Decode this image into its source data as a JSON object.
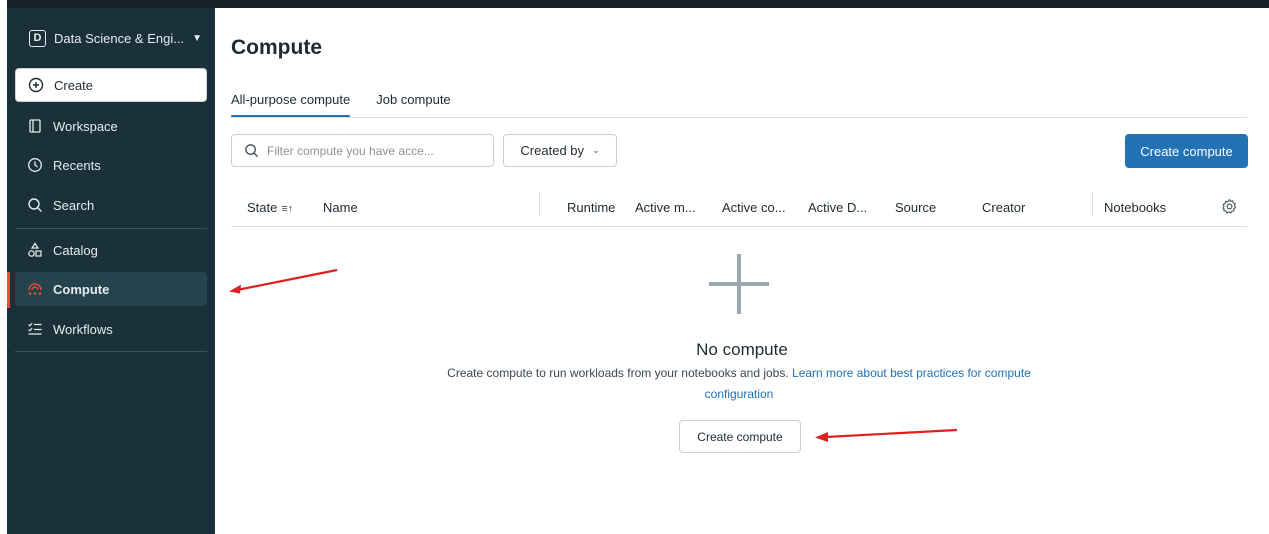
{
  "workspace": {
    "badge": "D",
    "name": "Data Science & Engi..."
  },
  "sidebar": {
    "create_label": "Create",
    "items": [
      {
        "label": "Workspace",
        "icon": "workspace-icon"
      },
      {
        "label": "Recents",
        "icon": "clock-icon"
      },
      {
        "label": "Search",
        "icon": "search-icon"
      },
      {
        "label": "Catalog",
        "icon": "catalog-icon"
      },
      {
        "label": "Compute",
        "icon": "compute-icon",
        "active": true
      },
      {
        "label": "Workflows",
        "icon": "workflows-icon"
      }
    ]
  },
  "main": {
    "title": "Compute",
    "tabs": [
      {
        "label": "All-purpose compute",
        "active": true
      },
      {
        "label": "Job compute",
        "active": false
      }
    ],
    "search": {
      "placeholder": "Filter compute you have acce..."
    },
    "filter_label": "Created by",
    "create_button": "Create compute",
    "table": {
      "columns": [
        "State",
        "Name",
        "Runtime",
        "Active m...",
        "Active co...",
        "Active D...",
        "Source",
        "Creator",
        "Notebooks"
      ]
    },
    "empty": {
      "title": "No compute",
      "desc": "Create compute to run workloads from your notebooks and jobs.",
      "link_text": "Learn more about best practices for compute configuration",
      "button": "Create compute"
    }
  },
  "colors": {
    "sidebar_bg": "#1b3139",
    "accent_blue": "#2272b4",
    "active_marker": "#e84c3d",
    "annotation_arrow": "#e02020"
  }
}
